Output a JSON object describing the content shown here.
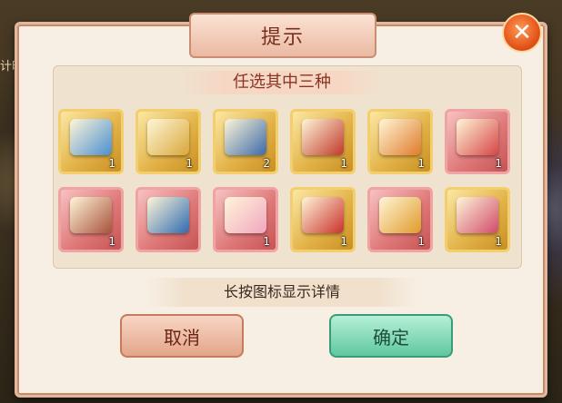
{
  "background": {
    "timer_label": "计时:"
  },
  "dialog": {
    "title": "提示",
    "subtitle": "任选其中三种",
    "hint": "长按图标显示详情",
    "cancel_label": "取消",
    "confirm_label": "确定",
    "close_glyph": "✕"
  },
  "items": [
    {
      "count": "1",
      "frame": "gold",
      "icon": "blue-gift-box-icon"
    },
    {
      "count": "1",
      "frame": "gold",
      "icon": "gold-box-dice-icon"
    },
    {
      "count": "2",
      "frame": "gold",
      "icon": "blue-lantern-chest-icon"
    },
    {
      "count": "1",
      "frame": "gold",
      "icon": "red-chest-character-icon"
    },
    {
      "count": "1",
      "frame": "gold",
      "icon": "orange-gift-box-icon"
    },
    {
      "count": "1",
      "frame": "red",
      "icon": "red-pouch-flowers-icon"
    },
    {
      "count": "1",
      "frame": "red",
      "icon": "bronze-octagon-box-icon"
    },
    {
      "count": "",
      "frame": "red",
      "icon": "blue-box-dice-icon"
    },
    {
      "count": "1",
      "frame": "red",
      "icon": "pink-flower-gift-box-icon"
    },
    {
      "count": "1",
      "frame": "gold",
      "icon": "ornate-treasure-chest-icon"
    },
    {
      "count": "1",
      "frame": "red",
      "icon": "gold-money-bag-icon"
    },
    {
      "count": "1",
      "frame": "gold",
      "icon": "jewel-treasure-chest-icon"
    }
  ]
}
